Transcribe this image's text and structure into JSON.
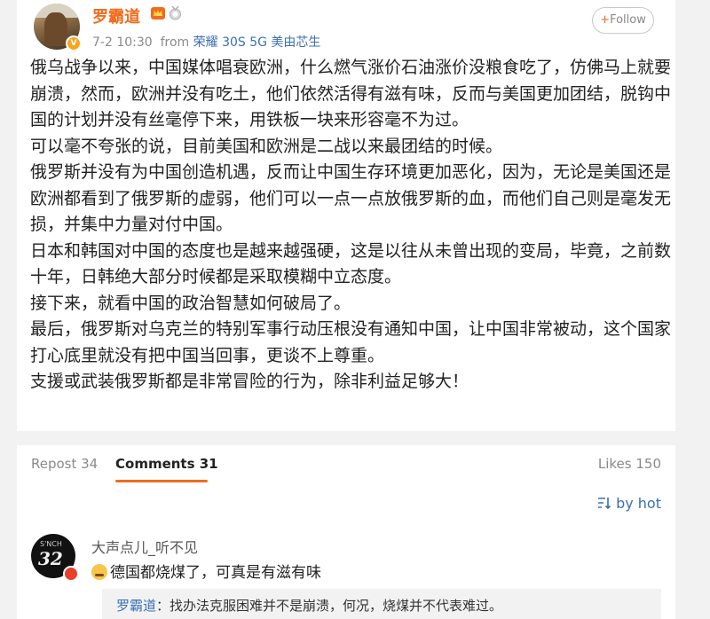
{
  "post": {
    "author": "罗霸道",
    "time": "7-2 10:30",
    "from_label": "from",
    "source": "荣耀 30S 5G 美由芯生",
    "follow_plus": "+",
    "follow_label": "Follow",
    "paragraphs": [
      "俄乌战争以来，中国媒体唱衰欧洲，什么燃气涨价石油涨价没粮食吃了，仿佛马上就要崩溃，然而，欧洲并没有吃土，他们依然活得有滋有味，反而与美国更加团结，脱钩中国的计划并没有丝毫停下来，用铁板一块来形容毫不为过。",
      "可以毫不夸张的说，目前美国和欧洲是二战以来最团结的时候。",
      "俄罗斯并没有为中国创造机遇，反而让中国生存环境更加恶化，因为，无论是美国还是欧洲都看到了俄罗斯的虚弱，他们可以一点一点放俄罗斯的血，而他们自己则是毫发无损，并集中力量对付中国。",
      "日本和韩国对中国的态度也是越来越强硬，这是以往从未曾出现的变局，毕竟，之前数十年，日韩绝大部分时候都是采取模糊中立态度。",
      "接下来，就看中国的政治智慧如何破局了。",
      "最后，俄罗斯对乌克兰的特别军事行动压根没有通知中国，让中国非常被动，这个国家打心底里就没有把中国当回事，更谈不上尊重。",
      "支援或武装俄罗斯都是非常冒险的行为，除非利益足够大！"
    ]
  },
  "tabs": {
    "repost": "Repost 34",
    "comments": "Comments 31",
    "likes": "Likes 150"
  },
  "sort": {
    "label": "by hot",
    "icon": "sort-icon"
  },
  "comment": {
    "author": "大声点儿_听不见",
    "avatar_text": "32",
    "text": "德国都烧煤了，可真是有滋有味",
    "reply_author": "罗霸道",
    "reply_text": "：找办法克服困难并不是崩溃，何况，烧煤并不代表难过。"
  },
  "colors": {
    "accent": "#f36b1c",
    "link": "#3a6fb3"
  }
}
